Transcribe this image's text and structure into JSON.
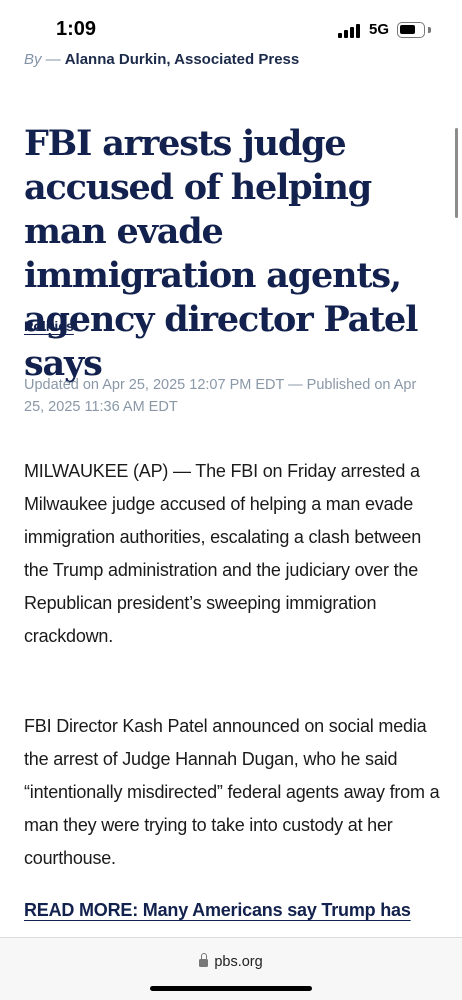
{
  "status_bar": {
    "time": "1:09",
    "network": "5G",
    "battery_level": 0.7
  },
  "article": {
    "byline_prefix": "By —",
    "author": "Alanna Durkin, Associated Press",
    "headline": "FBI arrests judge accused of helping man evade immigration agents, agency director Patel says",
    "section": "Politics",
    "dateline": "Updated on Apr 25, 2025 12:07 PM EDT — Published on Apr 25, 2025 11:36 AM EDT",
    "paragraphs": [
      "MILWAUKEE (AP) — The FBI on Friday arrested a Milwaukee judge accused of helping a man evade immigration authorities, escalating a clash between the Trump administration and the judiciary over the Republican president’s sweeping immigration crackdown.",
      "FBI Director Kash Patel announced on social media the arrest of Judge Hannah Dugan, who he said “intentionally misdirected” federal agents away from a man they were trying to take into custody at her courthouse."
    ],
    "read_more": "READ MORE: Many Americans say Trump has"
  },
  "browser": {
    "url": "pbs.org",
    "lock_icon": "lock-icon"
  },
  "colors": {
    "headline": "#12214d",
    "meta": "#8a98a8",
    "text": "#1a1a1a"
  }
}
